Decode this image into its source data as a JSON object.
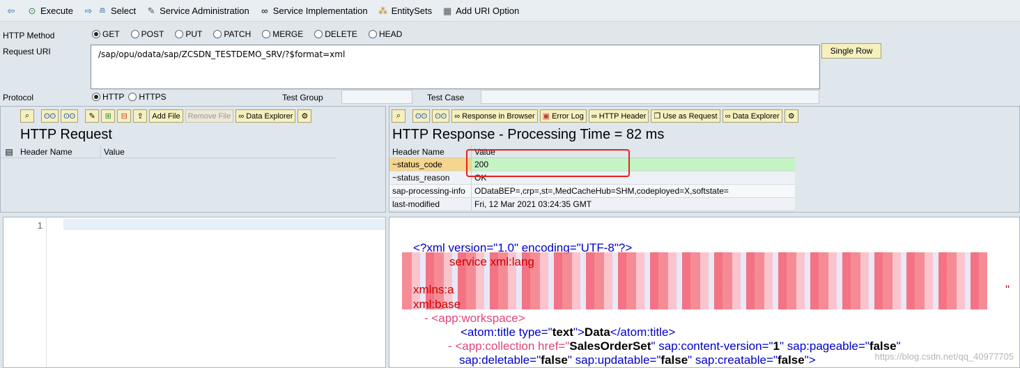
{
  "toolbar": {
    "execute": "Execute",
    "select": "Select",
    "service_admin": "Service Administration",
    "service_impl": "Service Implementation",
    "entity_sets": "EntitySets",
    "add_uri_option": "Add URI Option"
  },
  "form": {
    "http_method_label": "HTTP Method",
    "methods": [
      "GET",
      "POST",
      "PUT",
      "PATCH",
      "MERGE",
      "DELETE",
      "HEAD"
    ],
    "selected_method": "GET",
    "request_uri_label": "Request URI",
    "request_uri": "/sap/opu/odata/sap/ZCSDN_TESTDEMO_SRV/?$format=xml",
    "single_row": "Single Row",
    "protocol_label": "Protocol",
    "protocols": [
      "HTTP",
      "HTTPS"
    ],
    "selected_protocol": "HTTP",
    "test_group_label": "Test Group",
    "test_case_label": "Test Case"
  },
  "request": {
    "add_file": "Add File",
    "remove_file": "Remove File",
    "data_explorer": "Data Explorer",
    "title": "HTTP Request",
    "col_header_name": "Header Name",
    "col_value": "Value",
    "line_number": "1"
  },
  "response": {
    "response_in_browser": "Response in Browser",
    "error_log": "Error Log",
    "http_header": "HTTP Header",
    "use_as_request": "Use as Request",
    "data_explorer": "Data Explorer",
    "title": "HTTP Response - Processing Time = 82  ms",
    "col_header_name": "Header Name",
    "col_value": "Value",
    "rows": [
      {
        "name": "~status_code",
        "value": "200"
      },
      {
        "name": "~status_reason",
        "value": "OK"
      },
      {
        "name": "sap-processing-info",
        "value": "ODataBEP=,crp=,st=,MedCacheHub=SHM,codeployed=X,softstate="
      },
      {
        "name": "last-modified",
        "value": "Fri, 12 Mar 2021 03:24:35 GMT"
      }
    ]
  },
  "xml": {
    "line1": "<?xml version=\"1.0\" encoding=\"UTF-8\"?>",
    "partial_service": "service xml:lang",
    "partial_xmlns": "xmlns:a",
    "partial_xmlbase": "xml:base",
    "workspace": "- <app:workspace>",
    "title_open": "<atom:title type=\"",
    "title_type": "text",
    "title_close_q": "\">",
    "title_value": "Data",
    "title_end": "</atom:title>",
    "coll_prefix": "- <app:collection href=\"",
    "coll_href": "SalesOrderSet",
    "coll_cv": "\" sap:content-version=\"",
    "coll_cv_val": "1",
    "coll_pg": "\" sap:pageable=\"",
    "coll_pg_val": "false",
    "coll_end": "\"",
    "del_attr": "sap:deletable=\"",
    "del_val": "false",
    "upd_attr": "\" sap:updatable=\"",
    "upd_val": "false",
    "cre_attr": "\" sap:creatable=\"",
    "cre_val": "false",
    "close": "\">",
    "quote_end": "\""
  },
  "watermark": "https://blog.csdn.net/qq_40977705"
}
